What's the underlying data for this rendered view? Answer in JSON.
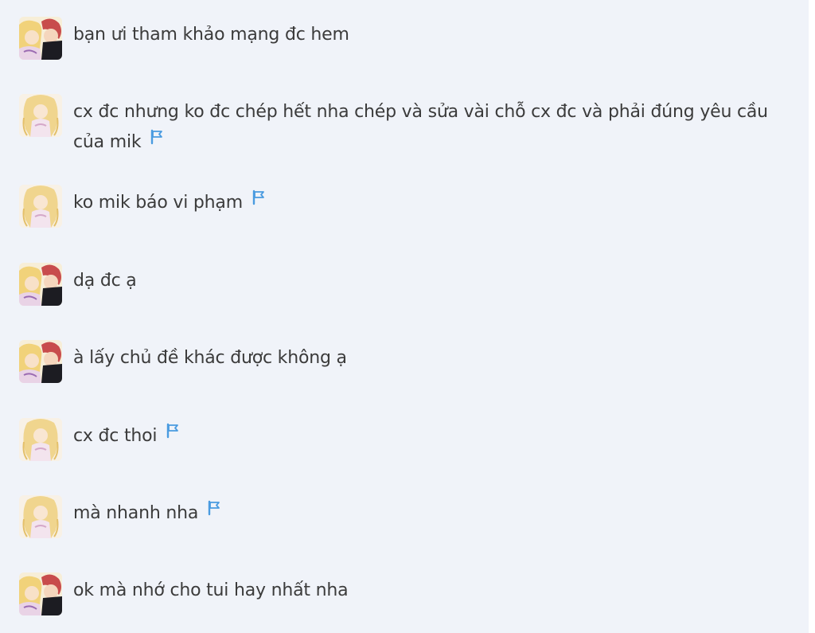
{
  "messages": [
    {
      "text": "bạn ưi tham khảo mạng đc hem",
      "sender": "other",
      "flag": false
    },
    {
      "text": "cx đc nhưng ko đc chép hết nha chép và sửa  vài chỗ cx đc và phải đúng yêu cầu của mik",
      "sender": "self",
      "flag": true
    },
    {
      "text": "ko mik báo vi phạm",
      "sender": "self",
      "flag": true
    },
    {
      "text": "dạ đc ạ",
      "sender": "other",
      "flag": false
    },
    {
      "text": "à lấy chủ đề khác được không ạ",
      "sender": "other",
      "flag": false
    },
    {
      "text": "cx đc thoi",
      "sender": "self",
      "flag": true
    },
    {
      "text": "mà nhanh nha",
      "sender": "self",
      "flag": true
    },
    {
      "text": "ok mà nhớ cho tui hay nhất nha",
      "sender": "other",
      "flag": false
    }
  ],
  "icons": {
    "flag": "report-flag-icon",
    "avatar_other": "avatar-couple",
    "avatar_self": "avatar-blonde-girl"
  },
  "colors": {
    "background": "#f0f3f9",
    "text": "#3b3b3b",
    "flag": "#4a9be0"
  }
}
